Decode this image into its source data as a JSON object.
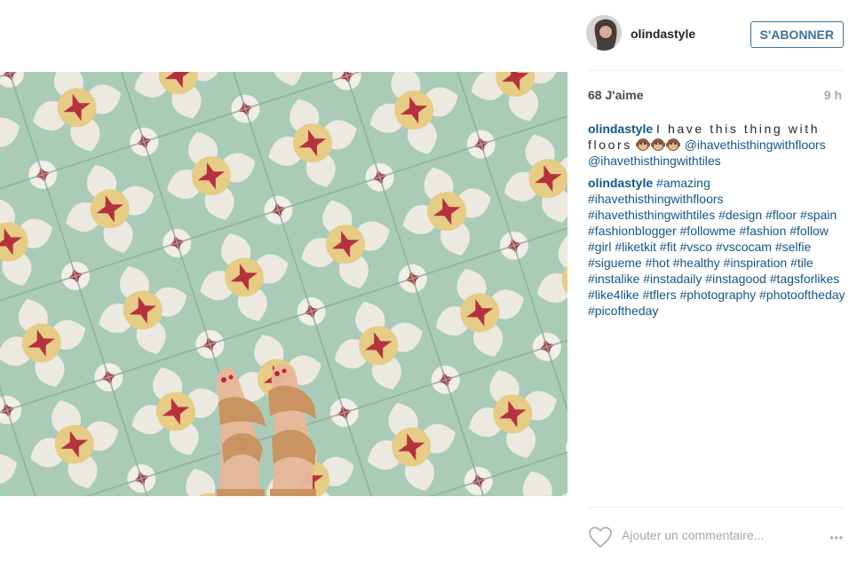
{
  "header": {
    "username": "olindastyle",
    "follow_label": "S'ABONNER"
  },
  "post": {
    "likes": "68 J'aime",
    "time": "9 h",
    "caption": {
      "author": "olindastyle",
      "text": "I have this thing with floors",
      "emojis": [
        "monkey-face-emoji",
        "monkey-face-emoji",
        "monkey-face-emoji"
      ],
      "mention_1": "@ihavethisthingwithfloors",
      "mention_2": "@ihavethisthingwithtiles"
    },
    "comment": {
      "author": "olindastyle",
      "hashtags": "#amazing #ihavethisthingwithfloors #ihavethisthingwithtiles #design #floor #spain #fashionblogger #followme #fashion #follow #girl #liketkit #fit #vsco #vscocam #selfie #sigueme #hot #healthy #inspiration #tile #instalike #instadaily #instagood #tagsforlikes #like4like #tflers #photography #photooftheday #picoftheday"
    }
  },
  "footer": {
    "comment_placeholder": "Ajouter un commentaire...",
    "more_label": "•••"
  },
  "icons": {
    "heart": "heart-outline-icon",
    "more": "more-options-icon"
  },
  "colors": {
    "link": "#125688",
    "follow": "#3f729b",
    "muted": "#a5a7aa",
    "tile_green": "#a9cbb8",
    "tile_red": "#b5313f",
    "tile_yellow": "#e6cc84"
  }
}
